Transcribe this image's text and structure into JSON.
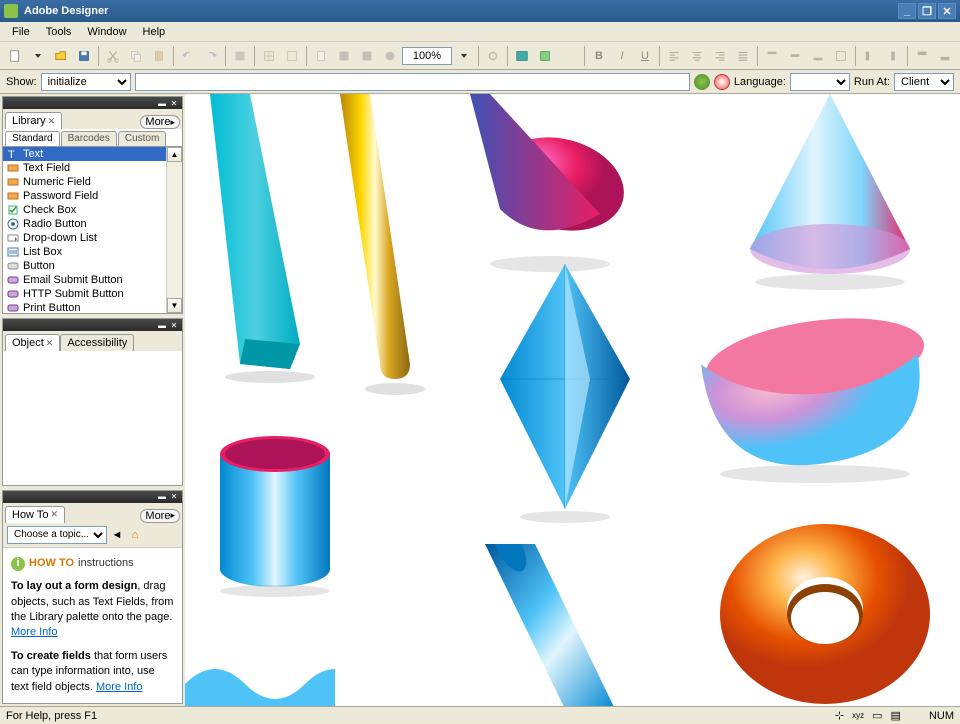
{
  "app": {
    "title": "Adobe Designer"
  },
  "menu": [
    "File",
    "Tools",
    "Window",
    "Help"
  ],
  "zoom": "100%",
  "showbar": {
    "label": "Show:",
    "value": "initialize",
    "langLabel": "Language:",
    "runLabel": "Run At:",
    "runValue": "Client"
  },
  "panels": {
    "library": {
      "title": "Library",
      "more": "More",
      "subtabs": [
        "Standard",
        "Barcodes",
        "Custom"
      ],
      "items": [
        {
          "label": "Text",
          "color": "#4a7db5"
        },
        {
          "label": "Text Field",
          "color": "#d97706"
        },
        {
          "label": "Numeric Field",
          "color": "#d97706"
        },
        {
          "label": "Password Field",
          "color": "#d97706"
        },
        {
          "label": "Check Box",
          "color": "#22aa22"
        },
        {
          "label": "Radio Button",
          "color": "#3a6ea5"
        },
        {
          "label": "Drop-down List",
          "color": "#666"
        },
        {
          "label": "List Box",
          "color": "#4a7db5"
        },
        {
          "label": "Button",
          "color": "#999"
        },
        {
          "label": "Email Submit Button",
          "color": "#7a3a9a"
        },
        {
          "label": "HTTP Submit Button",
          "color": "#7a3a9a"
        },
        {
          "label": "Print Button",
          "color": "#7a3a9a"
        }
      ]
    },
    "object": {
      "title": "Object",
      "tab2": "Accessibility"
    },
    "howto": {
      "title": "How To",
      "more": "More",
      "topic": "Choose a topic...",
      "heading": "HOW TO",
      "headingSuffix": "instructions",
      "p1pre": "To lay out a form design",
      "p1": ", drag objects, such as Text Fields, from the Library palette onto the page. ",
      "p2pre": "To create fields",
      "p2": " that form users can type information into, use text field objects. ",
      "moreInfo": "More Info"
    }
  },
  "status": {
    "help": "For Help, press F1",
    "num": "NUM"
  }
}
